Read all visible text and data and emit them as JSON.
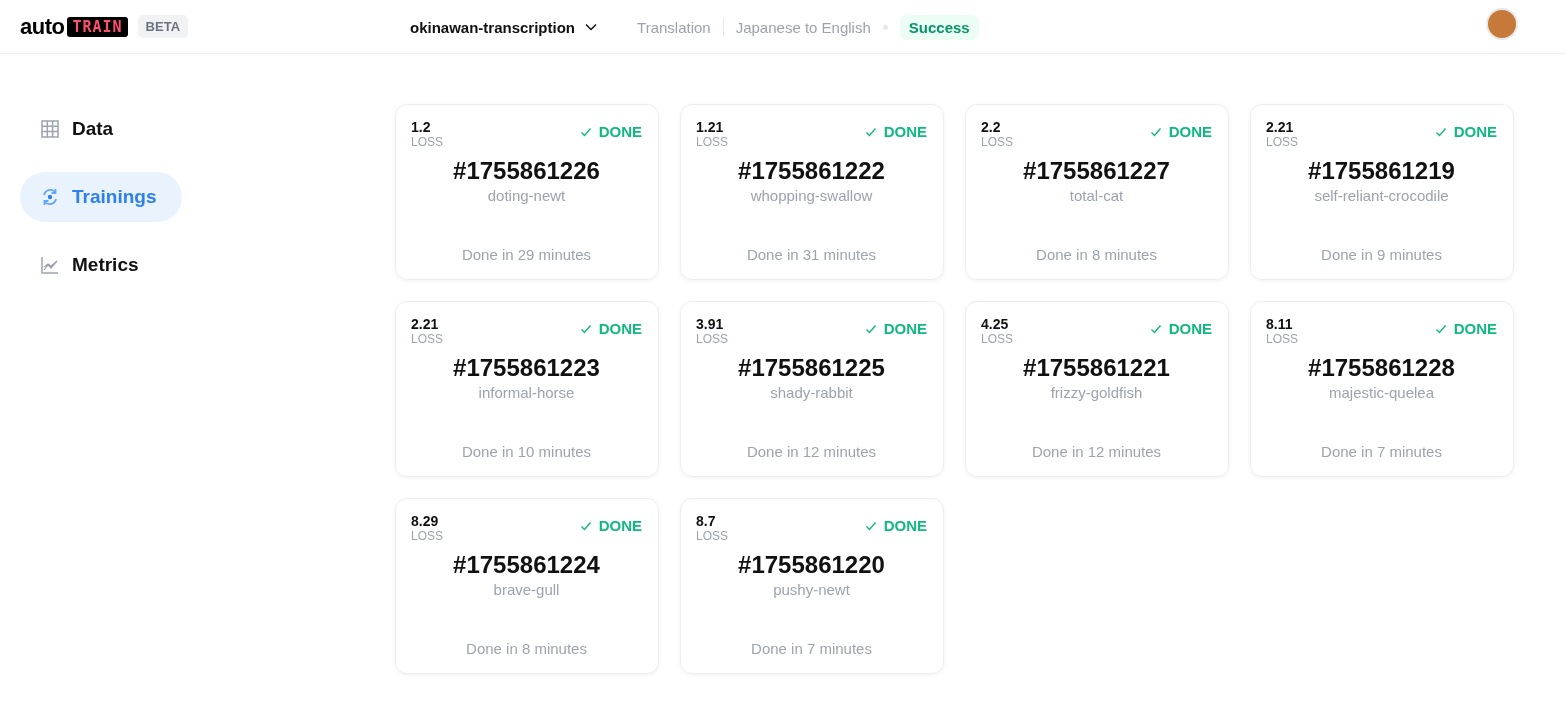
{
  "header": {
    "logo": {
      "word": "auto",
      "badge": "TRAIN"
    },
    "beta": "BETA",
    "project": "okinawan-transcription",
    "task": "Translation",
    "language_pair": "Japanese to English",
    "status": {
      "label": "Success",
      "kind": "success"
    }
  },
  "sidebar": {
    "items": [
      {
        "label": "Data",
        "kind": "data",
        "selected": false
      },
      {
        "label": "Trainings",
        "kind": "trainings",
        "selected": true
      },
      {
        "label": "Metrics",
        "kind": "metrics",
        "selected": false
      }
    ]
  },
  "trainings": [
    {
      "loss": "1.2",
      "loss_label": "LOSS",
      "status": "DONE",
      "kind": "done",
      "id": "#1755861226",
      "name": "doting-newt",
      "duration": "Done in 29 minutes"
    },
    {
      "loss": "1.21",
      "loss_label": "LOSS",
      "status": "DONE",
      "kind": "done",
      "id": "#1755861222",
      "name": "whopping-swallow",
      "duration": "Done in 31 minutes"
    },
    {
      "loss": "2.2",
      "loss_label": "LOSS",
      "status": "DONE",
      "kind": "done",
      "id": "#1755861227",
      "name": "total-cat",
      "duration": "Done in 8 minutes"
    },
    {
      "loss": "2.21",
      "loss_label": "LOSS",
      "status": "DONE",
      "kind": "done",
      "id": "#1755861219",
      "name": "self-reliant-crocodile",
      "duration": "Done in 9 minutes"
    },
    {
      "loss": "2.21",
      "loss_label": "LOSS",
      "status": "DONE",
      "kind": "done",
      "id": "#1755861223",
      "name": "informal-horse",
      "duration": "Done in 10 minutes"
    },
    {
      "loss": "3.91",
      "loss_label": "LOSS",
      "status": "DONE",
      "kind": "done",
      "id": "#1755861225",
      "name": "shady-rabbit",
      "duration": "Done in 12 minutes"
    },
    {
      "loss": "4.25",
      "loss_label": "LOSS",
      "status": "DONE",
      "kind": "done",
      "id": "#1755861221",
      "name": "frizzy-goldfish",
      "duration": "Done in 12 minutes"
    },
    {
      "loss": "8.11",
      "loss_label": "LOSS",
      "status": "DONE",
      "kind": "done",
      "id": "#1755861228",
      "name": "majestic-quelea",
      "duration": "Done in 7 minutes"
    },
    {
      "loss": "8.29",
      "loss_label": "LOSS",
      "status": "DONE",
      "kind": "done",
      "id": "#1755861224",
      "name": "brave-gull",
      "duration": "Done in 8 minutes"
    },
    {
      "loss": "8.7",
      "loss_label": "LOSS",
      "status": "DONE",
      "kind": "done",
      "id": "#1755861220",
      "name": "pushy-newt",
      "duration": "Done in 7 minutes"
    }
  ]
}
